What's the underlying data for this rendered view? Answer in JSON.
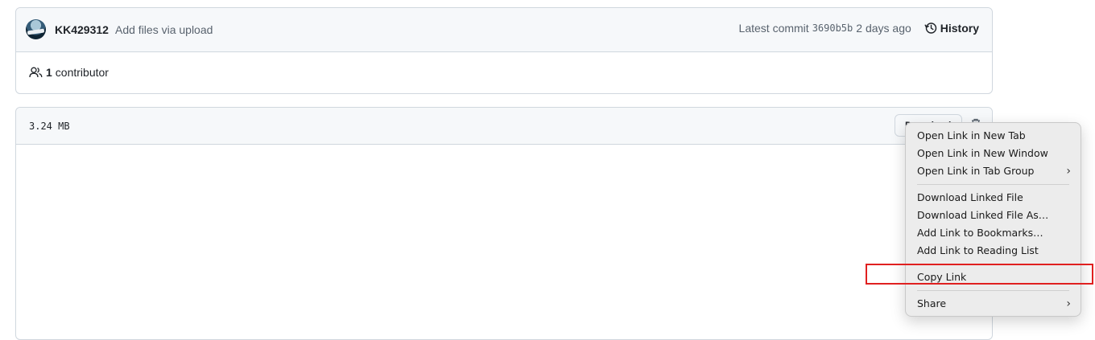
{
  "commit": {
    "author": "KK429312",
    "message": "Add files via upload",
    "latest_label": "Latest commit",
    "hash": "3690b5b",
    "time_ago": "2 days ago",
    "history_label": "History"
  },
  "contributors": {
    "count": "1",
    "label": "contributor"
  },
  "file": {
    "size": "3.24 MB",
    "download_label": "Download"
  },
  "context_menu": {
    "items": [
      {
        "label": "Open Link in New Tab"
      },
      {
        "label": "Open Link in New Window"
      },
      {
        "label": "Open Link in Tab Group",
        "submenu": true
      },
      {
        "label": "Download Linked File"
      },
      {
        "label": "Download Linked File As…"
      },
      {
        "label": "Add Link to Bookmarks…"
      },
      {
        "label": "Add Link to Reading List"
      },
      {
        "label": "Copy Link"
      },
      {
        "label": "Share",
        "submenu": true
      }
    ]
  },
  "colors": {
    "highlight": "#e02020",
    "menu_bg": "#ececec"
  }
}
